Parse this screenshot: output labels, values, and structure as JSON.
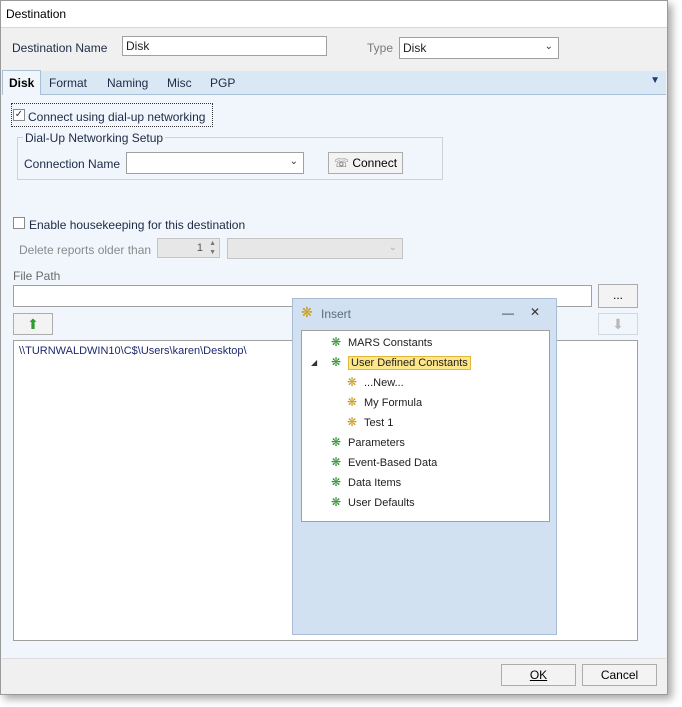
{
  "window": {
    "title": "Destination"
  },
  "header": {
    "destination_name_label": "Destination Name",
    "destination_name_value": "Disk",
    "type_label": "Type",
    "type_value": "Disk"
  },
  "tabs": [
    {
      "label": "Disk"
    },
    {
      "label": "Format"
    },
    {
      "label": "Naming"
    },
    {
      "label": "Misc"
    },
    {
      "label": "PGP"
    }
  ],
  "disk": {
    "dialup_checkbox_label": "Connect using dial-up networking",
    "dialup_group_title": "Dial-Up Networking Setup",
    "connection_name_label": "Connection Name",
    "connection_name_value": "",
    "connect_button": "Connect",
    "housekeeping_label": "Enable housekeeping for this destination",
    "delete_older_label": "Delete reports older than",
    "delete_older_value": "1",
    "file_path_label": "File Path",
    "file_path_value": "",
    "browse_button": "...",
    "paths": [
      "\\\\TURNWALDWIN10\\C$\\Users\\karen\\Desktop\\"
    ]
  },
  "insert_popup": {
    "title": "Insert",
    "tree": [
      {
        "label": "MARS Constants"
      },
      {
        "label": "User Defined Constants"
      },
      {
        "label": "...New..."
      },
      {
        "label": "My Formula"
      },
      {
        "label": "Test 1"
      },
      {
        "label": "Parameters"
      },
      {
        "label": "Event-Based Data"
      },
      {
        "label": "Data Items"
      },
      {
        "label": "User Defaults"
      }
    ]
  },
  "footer": {
    "ok": "OK",
    "cancel": "Cancel"
  }
}
